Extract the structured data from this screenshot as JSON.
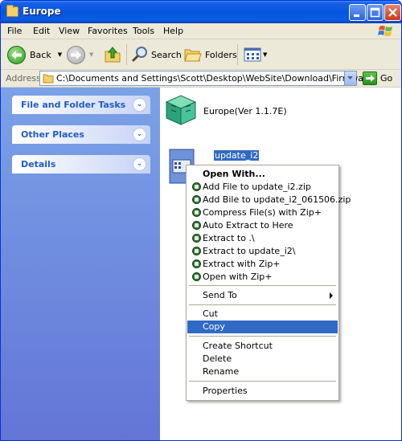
{
  "window": {
    "title": "Europe"
  },
  "menubar": {
    "items": [
      "File",
      "Edit",
      "View",
      "Favorites",
      "Tools",
      "Help"
    ]
  },
  "toolbar": {
    "back_label": "Back",
    "search_label": "Search",
    "folders_label": "Folders"
  },
  "address": {
    "label": "Address",
    "path": "C:\\Documents and Settings\\Scott\\Desktop\\WebSite\\Download\\Firmware",
    "go_label": "Go"
  },
  "sidebar": {
    "panels": [
      {
        "label": "File and Folder Tasks"
      },
      {
        "label": "Other Places"
      },
      {
        "label": "Details"
      }
    ]
  },
  "content": {
    "items": [
      {
        "name": "Europe(Ver 1.1.7E)"
      },
      {
        "name": "update_i2"
      }
    ]
  },
  "context_menu": {
    "open_with": "Open With...",
    "zip_items": [
      "Add File to update_i2.zip",
      "Add Bile to update_i2_061506.zip",
      "Compress File(s) with Zip+",
      "Auto Extract to Here",
      "Extract to .\\",
      "Extract to update_i2\\",
      "Extract with Zip+",
      "Open with Zip+"
    ],
    "send_to": "Send To",
    "cut": "Cut",
    "copy": "Copy",
    "create_shortcut": "Create Shortcut",
    "delete": "Delete",
    "rename": "Rename",
    "properties": "Properties",
    "highlighted": "Copy"
  }
}
